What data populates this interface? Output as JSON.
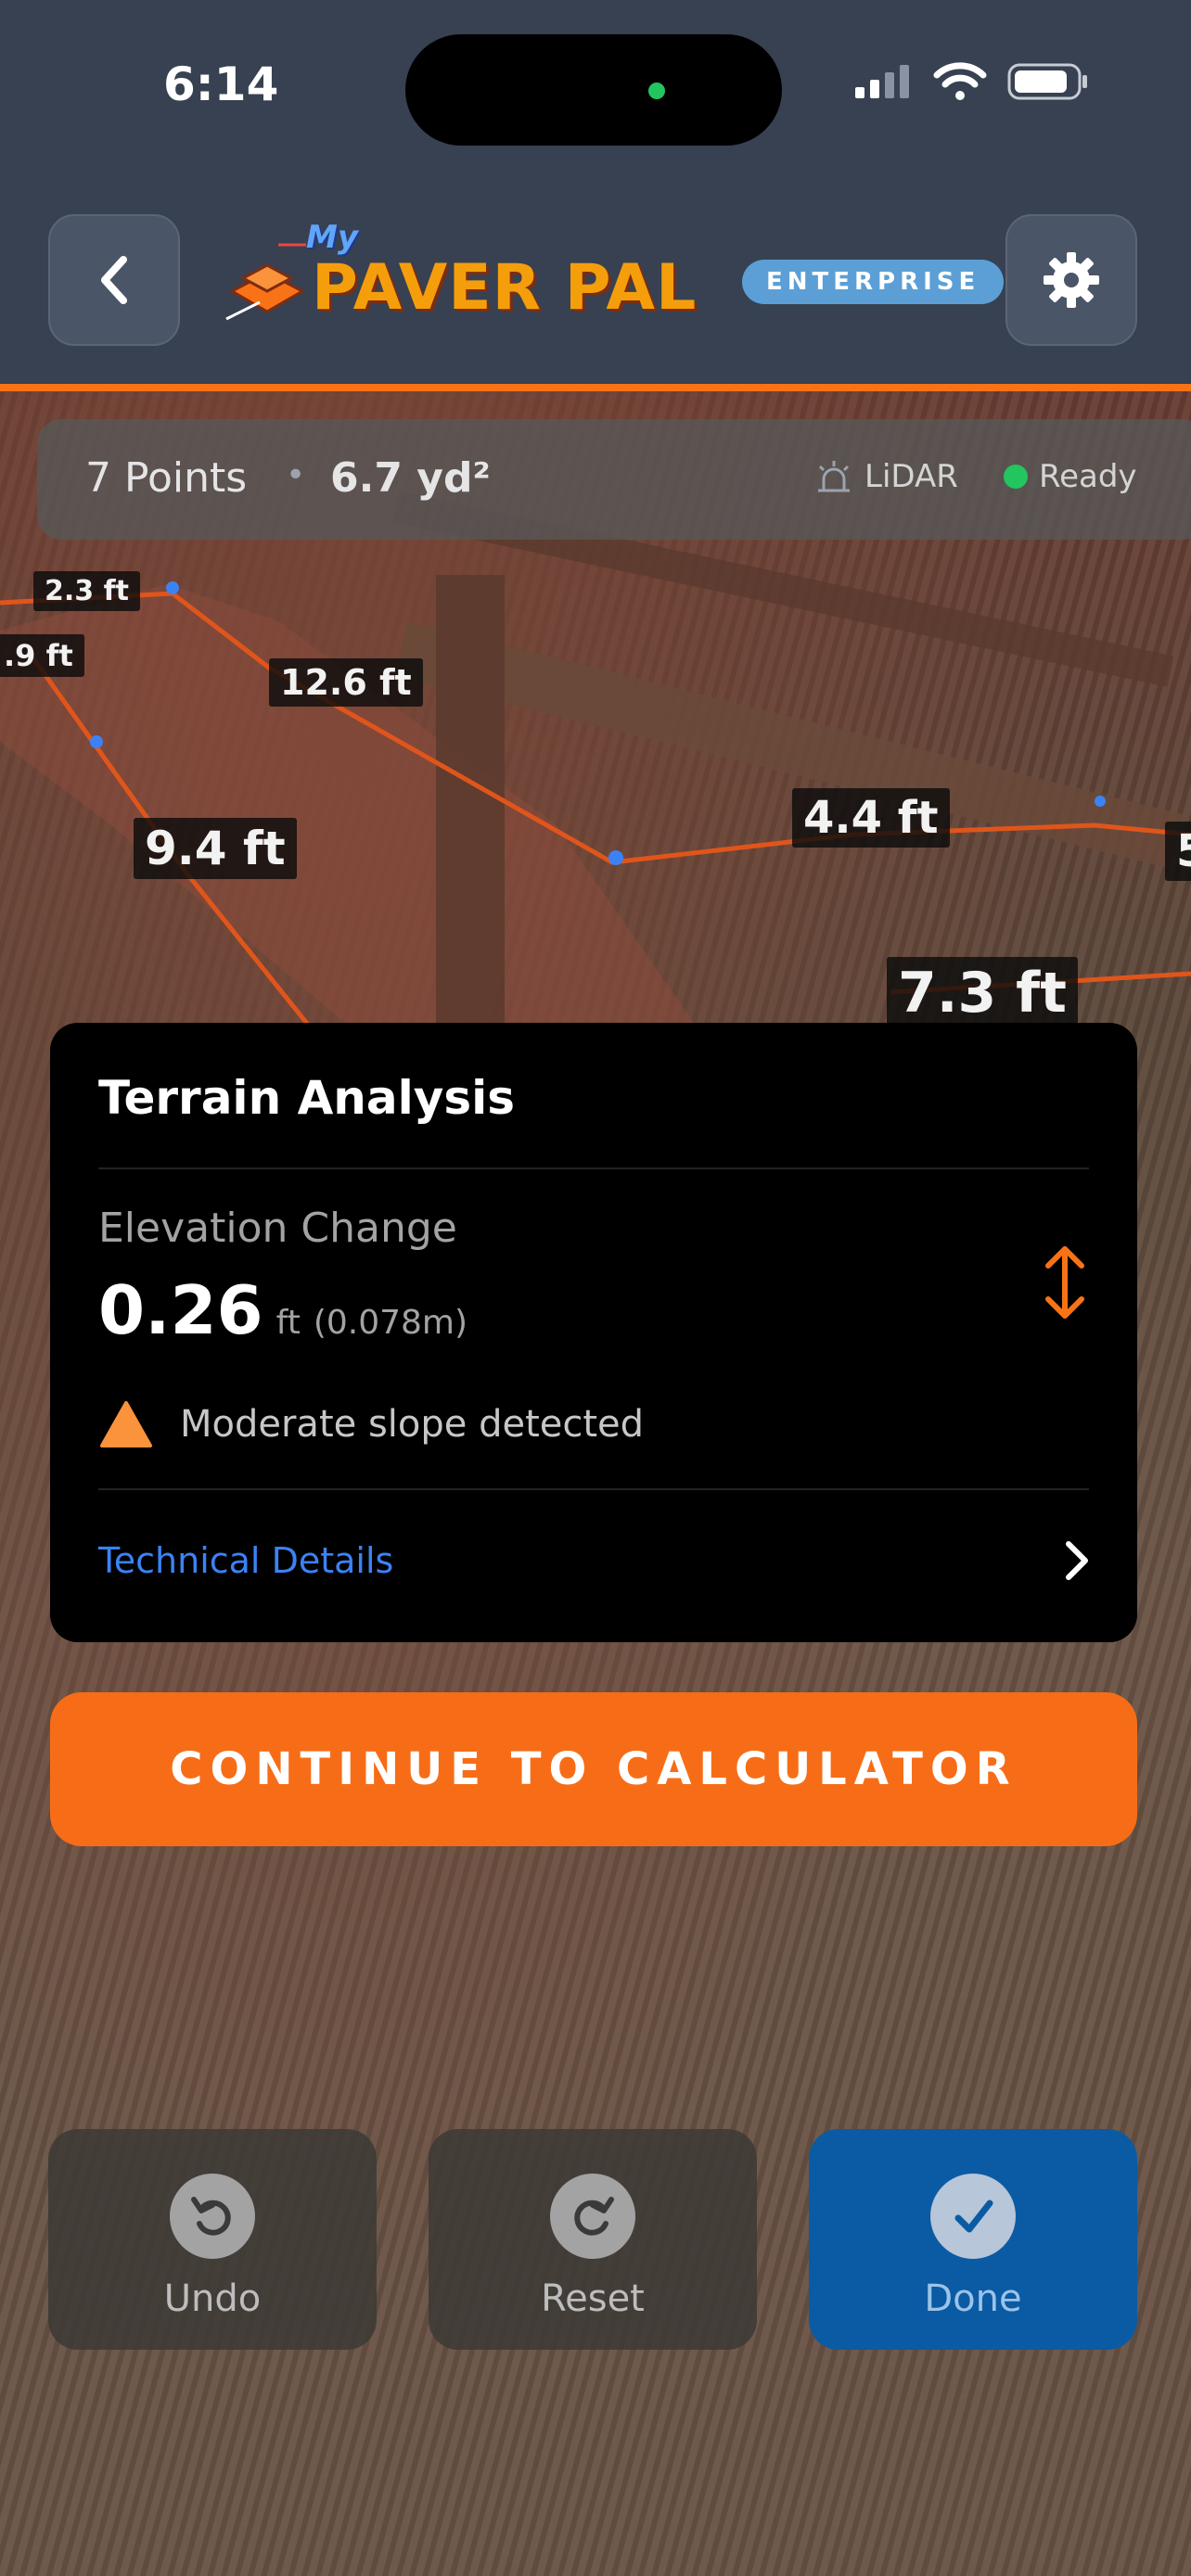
{
  "status_bar": {
    "time": "6:14"
  },
  "header": {
    "logo_my": "My",
    "logo_word": "PAVER PAL",
    "badge": "ENTERPRISE"
  },
  "info_bar": {
    "points": "7 Points",
    "separator": "•",
    "area": "6.7 yd²",
    "sensor": "LiDAR",
    "status": "Ready"
  },
  "measurements": [
    "2.3 ft",
    ".9 ft",
    "12.6 ft",
    "9.4 ft",
    "4.4 ft",
    "7.3 ft",
    "5"
  ],
  "terrain_card": {
    "title": "Terrain Analysis",
    "elevation_label": "Elevation Change",
    "elevation_value": "0.26",
    "elevation_unit": "ft",
    "elevation_metric": "(0.078m)",
    "warning": "Moderate slope detected",
    "details_link": "Technical Details"
  },
  "cta": {
    "label": "CONTINUE TO CALCULATOR"
  },
  "actions": [
    {
      "label": "Undo",
      "icon": "undo-icon"
    },
    {
      "label": "Reset",
      "icon": "reset-icon"
    },
    {
      "label": "Done",
      "icon": "checkmark-icon"
    }
  ],
  "colors": {
    "accent": "#f97316",
    "header": "#374151",
    "link": "#3b82f6",
    "done": "#0a5ba3",
    "ready": "#22c55e"
  }
}
